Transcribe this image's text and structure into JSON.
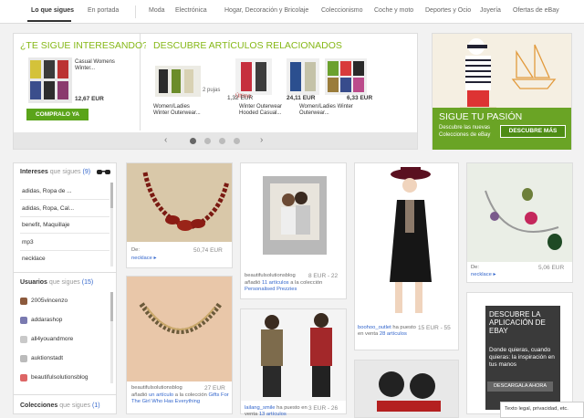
{
  "nav": {
    "items": [
      "Lo que sigues",
      "En portada",
      "Moda",
      "Electrónica",
      "Hogar, Decoración y Bricolaje",
      "Coleccionismo",
      "Coche y moto",
      "Deportes y Ocio",
      "Joyería",
      "Ofertas de eBay"
    ]
  },
  "recommended": {
    "heading": "¿TE SIGUE INTERESANDO?",
    "item_title": "Casual Womens Winter...",
    "price": "12,67 EUR",
    "button": "COMPRALO YA"
  },
  "related": {
    "heading": "DESCUBRE ARTÍCULOS RELACIONADOS",
    "items": [
      {
        "title": "Women/Ladies Winter Outerwear...",
        "price": "",
        "note": "2 pujas"
      },
      {
        "title": "Winter Outerwear Hooded Casual...",
        "price": "1,32 EUR",
        "note": "Último"
      },
      {
        "title": "Women/Ladies Winter Outerwear...",
        "price": "24,11 EUR",
        "note": ""
      },
      {
        "title": "",
        "price": "6,33 EUR",
        "note": ""
      }
    ]
  },
  "carousel": {
    "prev": "‹",
    "next": "›",
    "dots": 4,
    "active_dot": 0
  },
  "passion": {
    "title": "SIGUE TU PASIÓN",
    "text": "Descubre las nuevas Colecciones de eBay",
    "button": "DESCUBRE MÁS"
  },
  "sidebar": {
    "interests_title": "Intereses",
    "interests_suffix": "que sigues",
    "interests_count": "(9)",
    "interests": [
      "adidas, Ropa de ...",
      "adidas, Ropa, Cal...",
      "benefit, Maquillaje",
      "mp3",
      "necklace"
    ],
    "users_title": "Usuarios",
    "users_suffix": "que sigues",
    "users_count": "(15)",
    "users": [
      "2005vincenzo",
      "addarashop",
      "all4youandmore",
      "auktionstadt",
      "beautifulsolutionsblog"
    ],
    "collections_title": "Colecciones",
    "collections_suffix": "que sigues",
    "collections_count": "(1)"
  },
  "cards": {
    "c1": {
      "prefix": "De",
      "link": "necklace",
      "price": "50,74 EUR"
    },
    "c2": {
      "user": "beautifulsolutionsblog",
      "action": "añadió",
      "link1": "11 artículos",
      "mid": "a la colección",
      "link2": "Personalised Prezzies",
      "price": "8 EUR - 22"
    },
    "c3": {
      "user": "beautifulsolutionsblog",
      "action": "añadió",
      "link1": "un artículo",
      "mid": "a la colección",
      "link2": "Gifts For The Girl Who Has Everything",
      "price": "27 EUR"
    },
    "c4": {
      "user": "lailang_smile",
      "action": "ha puesto en venta",
      "link1": "13 artículos",
      "price": "3 EUR - 26"
    },
    "c5": {
      "user": "boohoo_outlet",
      "action": "ha puesto en venta",
      "link1": "28 artículos",
      "price": "15 EUR - 55"
    },
    "c6": {
      "prefix": "De",
      "link": "necklace",
      "price": "5,06 EUR"
    },
    "c7": {
      "title": "DESCUBRE LA APLICACIÓN DE EBAY",
      "text": "Donde quieras, cuando quieras: la inspiración en tus manos",
      "button": "DESCARGALA AHORA"
    }
  },
  "footer": {
    "legal": "Texto legal, privacidad, etc."
  },
  "colors": {
    "accent": "#86b817",
    "button_green": "#5aa41a",
    "link": "#3366cc"
  }
}
